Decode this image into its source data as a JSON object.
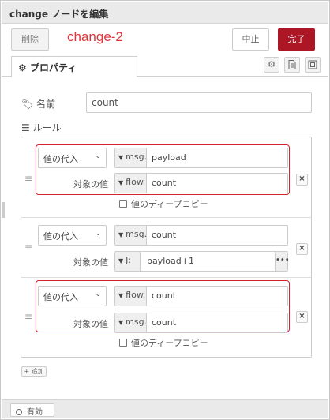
{
  "title": "change ノードを編集",
  "annotation": "change-2",
  "buttons": {
    "delete": "削除",
    "cancel": "中止",
    "done": "完了"
  },
  "tabs": {
    "properties": "プロパティ"
  },
  "name_field": {
    "label": "名前",
    "value": "count"
  },
  "rules_label": "ルール",
  "rules": [
    {
      "action": "値の代入",
      "target": {
        "type": "msg.",
        "value": "payload"
      },
      "value_label": "対象の値",
      "value": {
        "type": "flow.",
        "value": "count"
      },
      "deep_copy": "値のディープコピー"
    },
    {
      "action": "値の代入",
      "target": {
        "type": "msg.",
        "value": "count"
      },
      "value_label": "対象の値",
      "value": {
        "type": "J:",
        "value": "payload+1"
      }
    },
    {
      "action": "値の代入",
      "target": {
        "type": "flow.",
        "value": "count"
      },
      "value_label": "対象の値",
      "value": {
        "type": "msg.",
        "value": "count"
      },
      "deep_copy": "値のディープコピー"
    }
  ],
  "add_button": "追加",
  "footer": {
    "enable": "有効"
  },
  "colors": {
    "done_button": "#ad1625",
    "highlight": "#d7212f",
    "annotation": "#e0343a"
  }
}
